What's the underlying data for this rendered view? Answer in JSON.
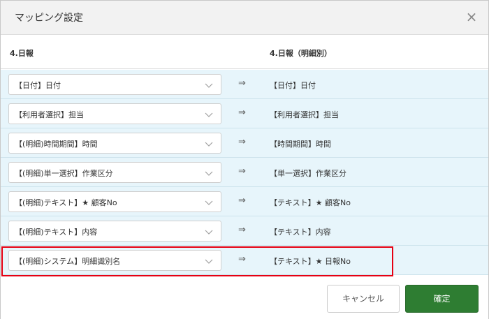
{
  "dialog": {
    "title": "マッピング設定",
    "close_icon": "close-icon"
  },
  "columns": {
    "source": "4.日報",
    "target": "4.日報（明細別）"
  },
  "arrow": "⇒",
  "rows": [
    {
      "source": "【日付】日付",
      "target": "【日付】日付"
    },
    {
      "source": "【利用者選択】担当",
      "target": "【利用者選択】担当"
    },
    {
      "source": "【(明細)時間期間】時間",
      "target": "【時間期間】時間"
    },
    {
      "source": "【(明細)単一選択】作業区分",
      "target": "【単一選択】作業区分"
    },
    {
      "source": "【(明細)テキスト】★ 顧客No",
      "target": "【テキスト】★ 顧客No"
    },
    {
      "source": "【(明細)テキスト】内容",
      "target": "【テキスト】内容"
    },
    {
      "source": "【(明細)システム】明細識別名",
      "target": "【テキスト】★ 日報No"
    }
  ],
  "highlighted_row": 6,
  "buttons": {
    "cancel": "キャンセル",
    "confirm": "確定"
  },
  "colors": {
    "row_bg": "#e7f5fb",
    "highlight": "#e60012",
    "confirm_bg": "#2e7d32"
  }
}
